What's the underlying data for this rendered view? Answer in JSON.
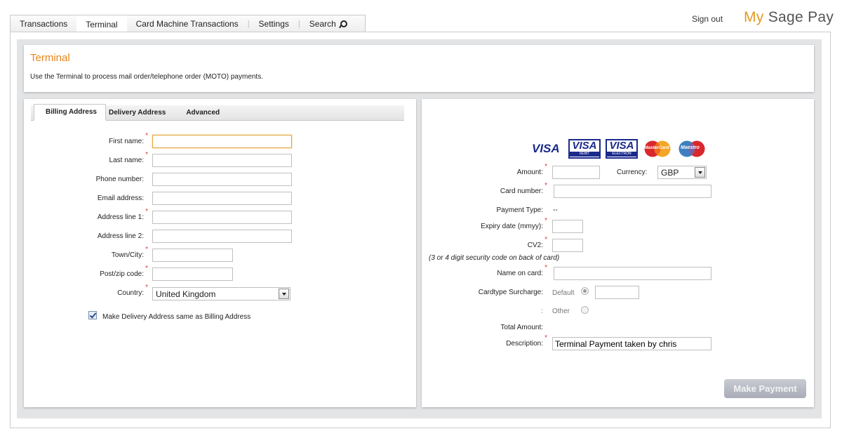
{
  "nav": {
    "tabs": [
      "Transactions",
      "Terminal",
      "Card Machine Transactions",
      "Settings",
      "Search"
    ],
    "active": "Terminal",
    "sign_out": "Sign out",
    "brand_my": "My",
    "brand_rest": "Sage Pay"
  },
  "intro": {
    "title": "Terminal",
    "description": "Use the Terminal to process mail order/telephone order (MOTO) payments."
  },
  "address": {
    "tabs": [
      "Billing Address",
      "Delivery Address",
      "Advanced"
    ],
    "fields": {
      "first_name": {
        "label": "First name:",
        "value": ""
      },
      "last_name": {
        "label": "Last name:",
        "value": ""
      },
      "phone": {
        "label": "Phone number:",
        "value": ""
      },
      "email": {
        "label": "Email address:",
        "value": ""
      },
      "address1": {
        "label": "Address line 1:",
        "value": ""
      },
      "address2": {
        "label": "Address line 2:",
        "value": ""
      },
      "town": {
        "label": "Town/City:",
        "value": ""
      },
      "postcode": {
        "label": "Post/zip code:",
        "value": ""
      },
      "country": {
        "label": "Country:",
        "value": "United Kingdom"
      }
    },
    "same_as_billing": "Make Delivery Address same as Billing Address"
  },
  "payment": {
    "logos": [
      "VISA",
      "VISA",
      "VISA",
      "MasterCard",
      "Maestro"
    ],
    "logo_sub": [
      "",
      "DEBIT",
      "ELECTRON",
      "",
      ""
    ],
    "amount_label": "Amount:",
    "currency_label": "Currency:",
    "currency_value": "GBP",
    "card_number_label": "Card number:",
    "payment_type_label": "Payment Type:",
    "payment_type_value": "--",
    "expiry_label": "Expiry date (mmyy):",
    "cv2_label": "CV2:",
    "cv2_hint": "(3 or 4 digit security code on back of card)",
    "name_label": "Name on card:",
    "surcharge_label": "Cardtype Surcharge:",
    "surcharge_default": "Default",
    "surcharge_colon": ":",
    "surcharge_other": "Other",
    "total_label": "Total Amount:",
    "description_label": "Description:",
    "description_value": "Terminal Payment taken by chris",
    "submit": "Make Payment"
  },
  "colors": {
    "accent": "#e8861a",
    "required": "#d23b3b",
    "visa_blue": "#1a2a8c"
  }
}
